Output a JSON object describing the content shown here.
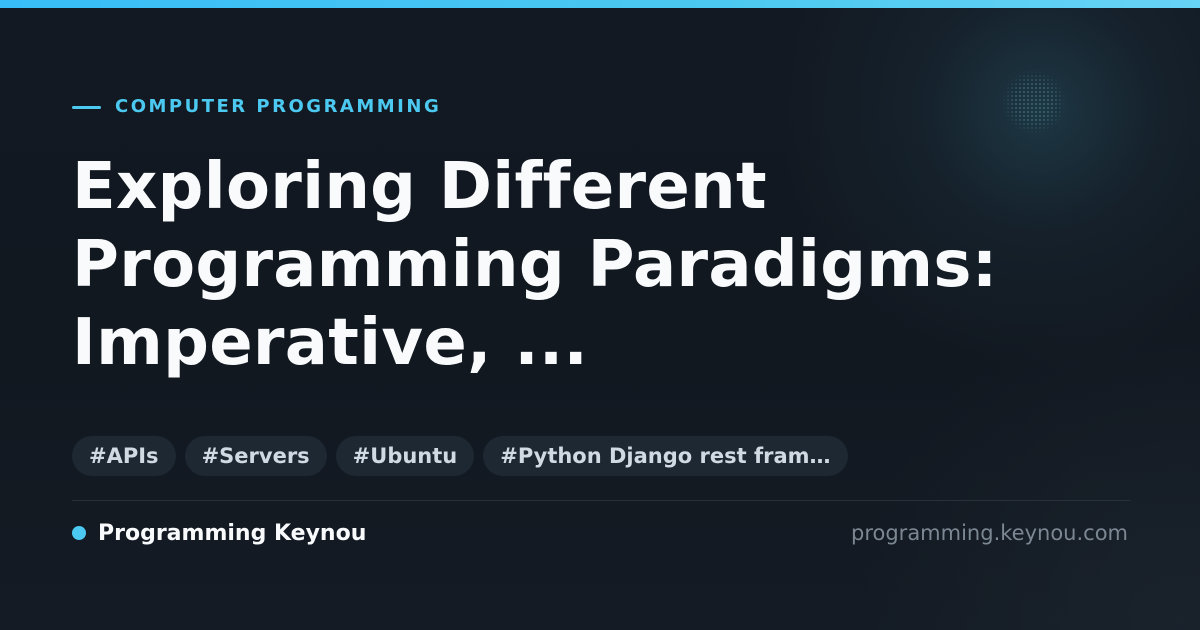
{
  "colors": {
    "accent": "#4cc9f0",
    "background": "#121820",
    "title": "#f8fafc",
    "tag_background": "#1e2833",
    "tag_text": "#d1d9e2",
    "url_text": "#7c8794"
  },
  "category": {
    "label": "COMPUTER PROGRAMMING"
  },
  "title": {
    "lines": [
      "Exploring Different",
      "Programming Paradigms:",
      "Imperative, ..."
    ]
  },
  "tags": [
    "#APIs",
    "#Servers",
    "#Ubuntu",
    "#Python Django rest fram…"
  ],
  "footer": {
    "brand": "Programming Keynou",
    "url": "programming.keynou.com"
  }
}
